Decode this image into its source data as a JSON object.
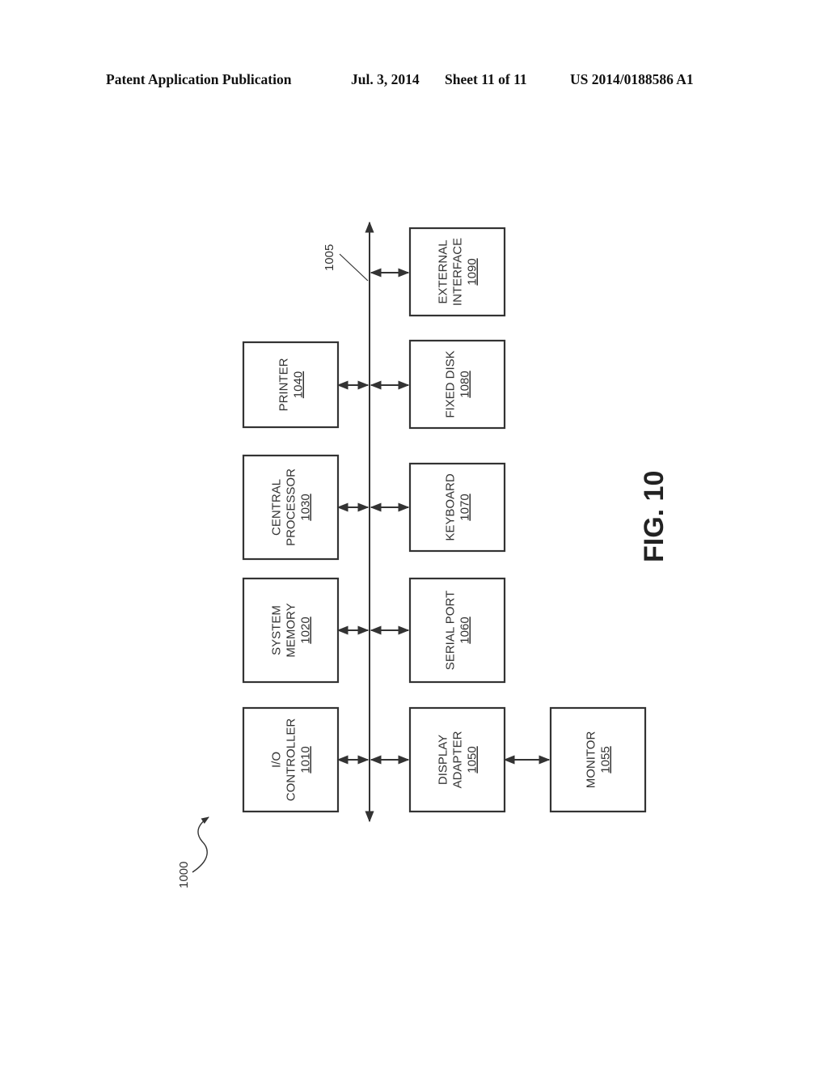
{
  "header": {
    "publication": "Patent Application Publication",
    "date": "Jul. 3, 2014",
    "sheet": "Sheet 11 of 11",
    "number": "US 2014/0188586 A1"
  },
  "figure": {
    "label": "FIG. 10",
    "system_ref": "1000",
    "bus_ref": "1005"
  },
  "blocks": [
    {
      "id": "io-controller",
      "lines": [
        "I/O",
        "CONTROLLER"
      ],
      "ref": "1010"
    },
    {
      "id": "system-memory",
      "lines": [
        "SYSTEM",
        "MEMORY"
      ],
      "ref": "1020"
    },
    {
      "id": "central-processor",
      "lines": [
        "CENTRAL",
        "PROCESSOR"
      ],
      "ref": "1030"
    },
    {
      "id": "printer",
      "lines": [
        "PRINTER"
      ],
      "ref": "1040"
    },
    {
      "id": "display-adapter",
      "lines": [
        "DISPLAY",
        "ADAPTER"
      ],
      "ref": "1050"
    },
    {
      "id": "monitor",
      "lines": [
        "MONITOR"
      ],
      "ref": "1055"
    },
    {
      "id": "serial-port",
      "lines": [
        "SERIAL PORT"
      ],
      "ref": "1060"
    },
    {
      "id": "keyboard",
      "lines": [
        "KEYBOARD"
      ],
      "ref": "1070"
    },
    {
      "id": "fixed-disk",
      "lines": [
        "FIXED DISK"
      ],
      "ref": "1080"
    },
    {
      "id": "external-interface",
      "lines": [
        "EXTERNAL",
        "INTERFACE"
      ],
      "ref": "1090"
    }
  ]
}
